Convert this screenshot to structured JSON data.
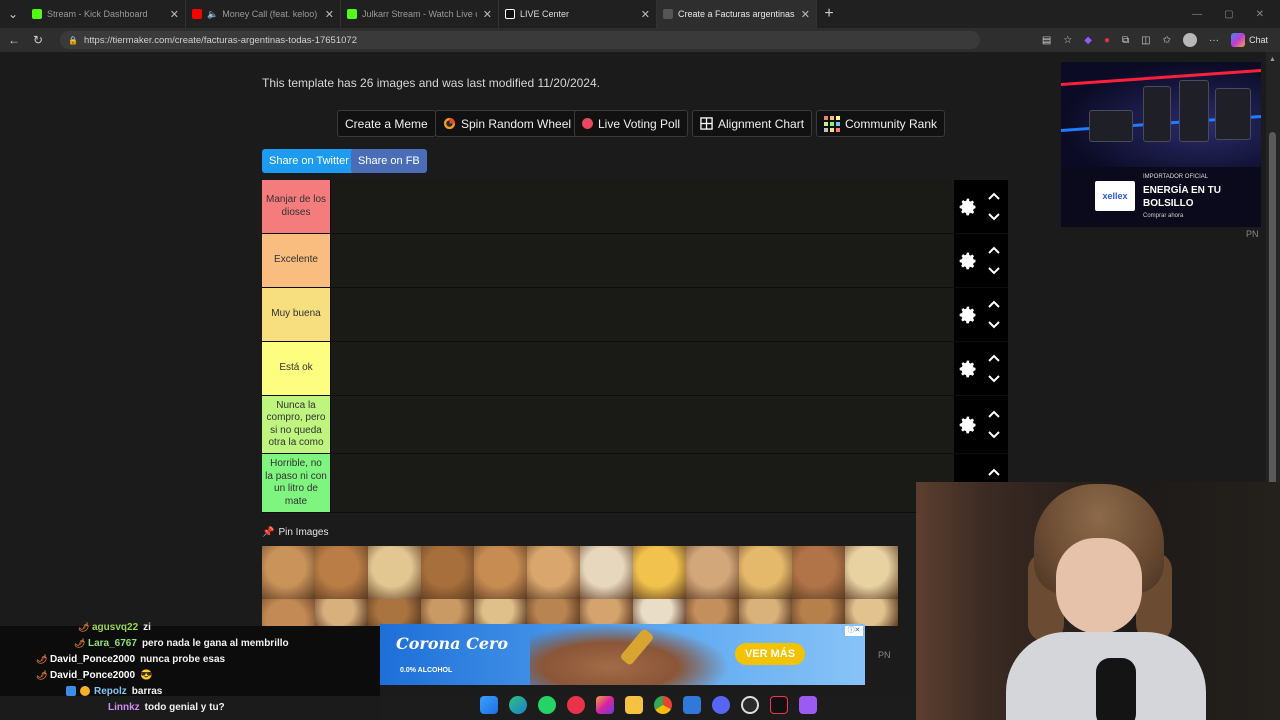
{
  "browser": {
    "tabs": [
      {
        "title": "Stream - Kick Dashboard",
        "icon_color": "#53fc18"
      },
      {
        "title": "Money Call (feat. keloo) - YouTube",
        "icon_color": "#ff0000"
      },
      {
        "title": "Julkarr Stream - Watch Live on Kick",
        "icon_color": "#53fc18"
      },
      {
        "title": "LIVE Center",
        "icon_color": "#ffffff"
      },
      {
        "title": "Create a Facturas argentinas (TODAS) Tier List",
        "icon_color": "#444444"
      }
    ],
    "url": "https://tiermaker.com/create/facturas-argentinas-todas-17651072",
    "chat_label": "Chat"
  },
  "page": {
    "template_info": "This template has 26 images and was last modified 11/20/2024.",
    "buttons": {
      "meme": "Create a Meme",
      "wheel": "Spin Random Wheel",
      "poll": "Live Voting Poll",
      "alignment": "Alignment Chart",
      "rank": "Community Rank"
    },
    "share": {
      "twitter": "Share on Twitter",
      "fb": "Share on FB"
    },
    "tiers": [
      {
        "label": "Manjar de los dioses",
        "color": "#f47c7c"
      },
      {
        "label": "Excelente",
        "color": "#f8bd7f"
      },
      {
        "label": "Muy buena",
        "color": "#f7df7f"
      },
      {
        "label": "Está ok",
        "color": "#fdfd7f"
      },
      {
        "label": "Nunca la compro, pero si no queda otra la como",
        "color": "#bff47f"
      },
      {
        "label": "Horrible, no la paso ni con un litro de mate",
        "color": "#7ff47f"
      }
    ],
    "pin_images": "Pin Images"
  },
  "ads": {
    "side": {
      "kicker": "IMPORTADOR OFICIAL",
      "headline": "ENERGÍA EN TU BOLSILLO",
      "cta": "Comprar ahora",
      "brand": "xellex",
      "marker": "PN"
    },
    "bottom": {
      "brand": "Corona Cero",
      "subline": "0.0% ALCOHOL",
      "cta": "VER MÁS",
      "marker": "PN"
    }
  },
  "chat": [
    {
      "user": "agusvq22",
      "message": "zi",
      "color": "#9cd64e"
    },
    {
      "user": "Lara_6767",
      "message": "pero nada le gana al membrillo",
      "color": "#8ee07a"
    },
    {
      "user": "David_Ponce2000",
      "message": "nunca probe esas",
      "color": "#ffffff"
    },
    {
      "user": "David_Ponce2000",
      "message": "😎",
      "color": "#ffffff"
    },
    {
      "user": "Repolz",
      "message": "barras",
      "color": "#7ec8f7"
    },
    {
      "user": "Linnkz",
      "message": "todo genial y tu?",
      "color": "#d38df2"
    }
  ],
  "thumb_colors": [
    "#c9935a",
    "#b97d45",
    "#e3c792",
    "#a76f3c",
    "#c68c52",
    "#d9a66d",
    "#e7d7bd",
    "#f1c24d",
    "#d2a77a",
    "#e5b96b",
    "#b07448",
    "#e8d2a2",
    "#c48a55",
    "#d7b07e",
    "#a9743f",
    "#c99a63",
    "#e0c08a",
    "#b88451",
    "#d4a36e",
    "#e9ddc8",
    "#c38f5c",
    "#d9b27b",
    "#b5804c",
    "#e2c390",
    "#cc9966",
    "#9c2a2a"
  ]
}
